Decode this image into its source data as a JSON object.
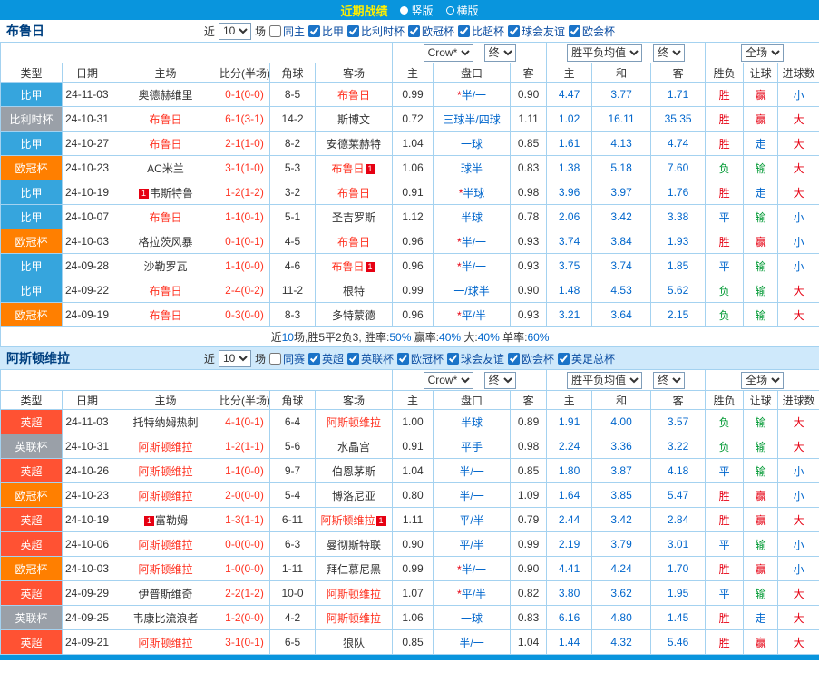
{
  "topbar": {
    "title": "近期战绩",
    "vertical": "竖版",
    "horizontal": "横版"
  },
  "columns": [
    "类型",
    "日期",
    "主场",
    "比分(半场)",
    "角球",
    "客场",
    "主",
    "盘口",
    "客",
    "主",
    "和",
    "客",
    "胜负",
    "让球",
    "进球数"
  ],
  "controls": {
    "company": "Crow*",
    "final1": "终",
    "avg": "胜平负均值",
    "final2": "终",
    "scope": "全场"
  },
  "colors": {
    "topbar_bg": "#0995dd",
    "grid_border": "#a4d2f0",
    "focal": "#ff3322",
    "score": "#ff3322",
    "handicap": "#0066cc",
    "avg": "#0066cc",
    "star": "#e60012",
    "league": {
      "比甲": "#36a5dd",
      "比利时杯": "#9aa0a8",
      "欧冠杯": "#ff7f00",
      "英超": "#ff5233",
      "英联杯": "#9aa0a8"
    }
  },
  "result_colors": {
    "胜": "#e60012",
    "平": "#0066cc",
    "负": "#009933"
  },
  "handicap_colors": {
    "赢": "#e60012",
    "走": "#0066cc",
    "输": "#009933"
  },
  "goal_colors": {
    "大": "#e60012",
    "小": "#0066cc"
  },
  "sections": [
    {
      "team": "布鲁日",
      "tint": false,
      "filter": {
        "near": "近",
        "count": "10",
        "games": "场",
        "same": "同主",
        "leagues": [
          "比甲",
          "比利时杯",
          "欧冠杯",
          "比超杯",
          "球会友谊",
          "欧会杯"
        ]
      },
      "rows": [
        {
          "lg": "比甲",
          "d": "24-11-03",
          "h": "奥德赫维里",
          "hf": 0,
          "s": "0-1(0-0)",
          "c": "8-5",
          "a": "布鲁日",
          "af": 1,
          "o1": "0.99",
          "hc": "*半/一",
          "o2": "0.90",
          "m1": "4.47",
          "m2": "3.77",
          "m3": "1.71",
          "r": "胜",
          "rb": "赢",
          "g": "小"
        },
        {
          "lg": "比利时杯",
          "d": "24-10-31",
          "h": "布鲁日",
          "hf": 1,
          "s": "6-1(3-1)",
          "c": "14-2",
          "a": "斯博文",
          "af": 0,
          "o1": "0.72",
          "hc": "三球半/四球",
          "o2": "1.11",
          "m1": "1.02",
          "m2": "16.11",
          "m3": "35.35",
          "r": "胜",
          "rb": "赢",
          "g": "大"
        },
        {
          "lg": "比甲",
          "d": "24-10-27",
          "h": "布鲁日",
          "hf": 1,
          "s": "2-1(1-0)",
          "c": "8-2",
          "a": "安德莱赫特",
          "af": 0,
          "o1": "1.04",
          "hc": "一球",
          "o2": "0.85",
          "m1": "1.61",
          "m2": "4.13",
          "m3": "4.74",
          "r": "胜",
          "rb": "走",
          "g": "大"
        },
        {
          "lg": "欧冠杯",
          "d": "24-10-23",
          "h": "AC米兰",
          "hf": 0,
          "s": "3-1(1-0)",
          "c": "5-3",
          "a": "布鲁日",
          "af": 1,
          "ab": "1",
          "o1": "1.06",
          "hc": "球半",
          "o2": "0.83",
          "m1": "1.38",
          "m2": "5.18",
          "m3": "7.60",
          "r": "负",
          "rb": "输",
          "g": "大"
        },
        {
          "lg": "比甲",
          "d": "24-10-19",
          "h": "韦斯特鲁",
          "hb": "1",
          "hf": 0,
          "s": "1-2(1-2)",
          "c": "3-2",
          "a": "布鲁日",
          "af": 1,
          "o1": "0.91",
          "hc": "*半球",
          "o2": "0.98",
          "m1": "3.96",
          "m2": "3.97",
          "m3": "1.76",
          "r": "胜",
          "rb": "走",
          "g": "大"
        },
        {
          "lg": "比甲",
          "d": "24-10-07",
          "h": "布鲁日",
          "hf": 1,
          "s": "1-1(0-1)",
          "c": "5-1",
          "a": "圣吉罗斯",
          "af": 0,
          "o1": "1.12",
          "hc": "半球",
          "o2": "0.78",
          "m1": "2.06",
          "m2": "3.42",
          "m3": "3.38",
          "r": "平",
          "rb": "输",
          "g": "小"
        },
        {
          "lg": "欧冠杯",
          "d": "24-10-03",
          "h": "格拉茨风暴",
          "hf": 0,
          "s": "0-1(0-1)",
          "c": "4-5",
          "a": "布鲁日",
          "af": 1,
          "o1": "0.96",
          "hc": "*半/一",
          "o2": "0.93",
          "m1": "3.74",
          "m2": "3.84",
          "m3": "1.93",
          "r": "胜",
          "rb": "赢",
          "g": "小"
        },
        {
          "lg": "比甲",
          "d": "24-09-28",
          "h": "沙勒罗瓦",
          "hf": 0,
          "s": "1-1(0-0)",
          "c": "4-6",
          "a": "布鲁日",
          "af": 1,
          "ab": "1",
          "o1": "0.96",
          "hc": "*半/一",
          "o2": "0.93",
          "m1": "3.75",
          "m2": "3.74",
          "m3": "1.85",
          "r": "平",
          "rb": "输",
          "g": "小"
        },
        {
          "lg": "比甲",
          "d": "24-09-22",
          "h": "布鲁日",
          "hf": 1,
          "s": "2-4(0-2)",
          "c": "11-2",
          "a": "根特",
          "af": 0,
          "o1": "0.99",
          "hc": "一/球半",
          "o2": "0.90",
          "m1": "1.48",
          "m2": "4.53",
          "m3": "5.62",
          "r": "负",
          "rb": "输",
          "g": "大"
        },
        {
          "lg": "欧冠杯",
          "d": "24-09-19",
          "h": "布鲁日",
          "hf": 1,
          "s": "0-3(0-0)",
          "c": "8-3",
          "a": "多特蒙德",
          "af": 0,
          "o1": "0.96",
          "hc": "*平/半",
          "o2": "0.93",
          "m1": "3.21",
          "m2": "3.64",
          "m3": "2.15",
          "r": "负",
          "rb": "输",
          "g": "大"
        }
      ],
      "summary": [
        {
          "t": "近",
          "c": "#333333"
        },
        {
          "t": "10",
          "c": "#0066cc"
        },
        {
          "t": "场,胜5平2负3, 胜率:",
          "c": "#333333"
        },
        {
          "t": "50%",
          "c": "#0066cc"
        },
        {
          "t": " 赢率:",
          "c": "#333333"
        },
        {
          "t": "40%",
          "c": "#0066cc"
        },
        {
          "t": " 大:",
          "c": "#333333"
        },
        {
          "t": "40%",
          "c": "#0066cc"
        },
        {
          "t": " 单率:",
          "c": "#333333"
        },
        {
          "t": "60%",
          "c": "#0066cc"
        }
      ]
    },
    {
      "team": "阿斯顿维拉",
      "tint": true,
      "filter": {
        "near": "近",
        "count": "10",
        "games": "场",
        "same": "同赛",
        "leagues": [
          "英超",
          "英联杯",
          "欧冠杯",
          "球会友谊",
          "欧会杯",
          "英足总杯"
        ]
      },
      "rows": [
        {
          "lg": "英超",
          "d": "24-11-03",
          "h": "托特纳姆热刺",
          "hf": 0,
          "s": "4-1(0-1)",
          "c": "6-4",
          "a": "阿斯顿维拉",
          "af": 1,
          "o1": "1.00",
          "hc": "半球",
          "o2": "0.89",
          "m1": "1.91",
          "m2": "4.00",
          "m3": "3.57",
          "r": "负",
          "rb": "输",
          "g": "大"
        },
        {
          "lg": "英联杯",
          "d": "24-10-31",
          "h": "阿斯顿维拉",
          "hf": 1,
          "s": "1-2(1-1)",
          "c": "5-6",
          "a": "水晶宫",
          "af": 0,
          "o1": "0.91",
          "hc": "平手",
          "o2": "0.98",
          "m1": "2.24",
          "m2": "3.36",
          "m3": "3.22",
          "r": "负",
          "rb": "输",
          "g": "大"
        },
        {
          "lg": "英超",
          "d": "24-10-26",
          "h": "阿斯顿维拉",
          "hf": 1,
          "s": "1-1(0-0)",
          "c": "9-7",
          "a": "伯恩茅斯",
          "af": 0,
          "o1": "1.04",
          "hc": "半/一",
          "o2": "0.85",
          "m1": "1.80",
          "m2": "3.87",
          "m3": "4.18",
          "r": "平",
          "rb": "输",
          "g": "小"
        },
        {
          "lg": "欧冠杯",
          "d": "24-10-23",
          "h": "阿斯顿维拉",
          "hf": 1,
          "s": "2-0(0-0)",
          "c": "5-4",
          "a": "博洛尼亚",
          "af": 0,
          "o1": "0.80",
          "hc": "半/一",
          "o2": "1.09",
          "m1": "1.64",
          "m2": "3.85",
          "m3": "5.47",
          "r": "胜",
          "rb": "赢",
          "g": "小"
        },
        {
          "lg": "英超",
          "d": "24-10-19",
          "h": "富勒姆",
          "hb": "1",
          "hf": 0,
          "s": "1-3(1-1)",
          "c": "6-11",
          "a": "阿斯顿维拉",
          "af": 1,
          "ab": "1",
          "o1": "1.11",
          "hc": "平/半",
          "o2": "0.79",
          "m1": "2.44",
          "m2": "3.42",
          "m3": "2.84",
          "r": "胜",
          "rb": "赢",
          "g": "大"
        },
        {
          "lg": "英超",
          "d": "24-10-06",
          "h": "阿斯顿维拉",
          "hf": 1,
          "s": "0-0(0-0)",
          "c": "6-3",
          "a": "曼彻斯特联",
          "af": 0,
          "o1": "0.90",
          "hc": "平/半",
          "o2": "0.99",
          "m1": "2.19",
          "m2": "3.79",
          "m3": "3.01",
          "r": "平",
          "rb": "输",
          "g": "小"
        },
        {
          "lg": "欧冠杯",
          "d": "24-10-03",
          "h": "阿斯顿维拉",
          "hf": 1,
          "s": "1-0(0-0)",
          "c": "1-11",
          "a": "拜仁慕尼黑",
          "af": 0,
          "o1": "0.99",
          "hc": "*半/一",
          "o2": "0.90",
          "m1": "4.41",
          "m2": "4.24",
          "m3": "1.70",
          "r": "胜",
          "rb": "赢",
          "g": "小"
        },
        {
          "lg": "英超",
          "d": "24-09-29",
          "h": "伊普斯维奇",
          "hf": 0,
          "s": "2-2(1-2)",
          "c": "10-0",
          "a": "阿斯顿维拉",
          "af": 1,
          "o1": "1.07",
          "hc": "*平/半",
          "o2": "0.82",
          "m1": "3.80",
          "m2": "3.62",
          "m3": "1.95",
          "r": "平",
          "rb": "输",
          "g": "大"
        },
        {
          "lg": "英联杯",
          "d": "24-09-25",
          "h": "韦康比流浪者",
          "hf": 0,
          "s": "1-2(0-0)",
          "c": "4-2",
          "a": "阿斯顿维拉",
          "af": 1,
          "o1": "1.06",
          "hc": "一球",
          "o2": "0.83",
          "m1": "6.16",
          "m2": "4.80",
          "m3": "1.45",
          "r": "胜",
          "rb": "走",
          "g": "大"
        },
        {
          "lg": "英超",
          "d": "24-09-21",
          "h": "阿斯顿维拉",
          "hf": 1,
          "s": "3-1(0-1)",
          "c": "6-5",
          "a": "狼队",
          "af": 0,
          "o1": "0.85",
          "hc": "半/一",
          "o2": "1.04",
          "m1": "1.44",
          "m2": "4.32",
          "m3": "5.46",
          "r": "胜",
          "rb": "赢",
          "g": "大"
        }
      ],
      "summary": null
    }
  ]
}
